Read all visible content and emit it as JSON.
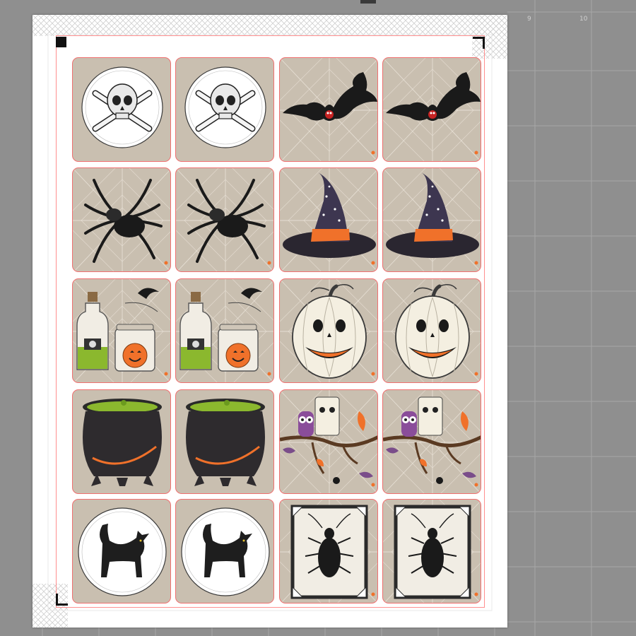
{
  "canvas": {
    "background_color": "#8f8f8f",
    "ruler_labels": [
      "9",
      "10"
    ]
  },
  "page": {
    "cut_line_color": "#ff8f8f",
    "registration_color": "#111111"
  },
  "stickers": [
    {
      "image": "skull-and-crossbones",
      "frame": "white-circle"
    },
    {
      "image": "skull-and-crossbones",
      "frame": "white-circle"
    },
    {
      "image": "bat",
      "frame": "cobweb"
    },
    {
      "image": "bat",
      "frame": "cobweb"
    },
    {
      "image": "spider",
      "frame": "cobweb"
    },
    {
      "image": "spider",
      "frame": "cobweb"
    },
    {
      "image": "witch-hat",
      "frame": "cobweb"
    },
    {
      "image": "witch-hat",
      "frame": "cobweb"
    },
    {
      "image": "potion-bottles",
      "frame": "cobweb"
    },
    {
      "image": "potion-bottles",
      "frame": "cobweb"
    },
    {
      "image": "jack-o-lantern",
      "frame": "cobweb"
    },
    {
      "image": "jack-o-lantern",
      "frame": "cobweb"
    },
    {
      "image": "cauldron",
      "frame": "cobweb"
    },
    {
      "image": "cauldron",
      "frame": "cobweb"
    },
    {
      "image": "owls-on-branch",
      "frame": "cobweb"
    },
    {
      "image": "owls-on-branch",
      "frame": "cobweb"
    },
    {
      "image": "black-cat",
      "frame": "white-circle"
    },
    {
      "image": "black-cat",
      "frame": "white-circle"
    },
    {
      "image": "framed-beetle",
      "frame": "cobweb"
    },
    {
      "image": "framed-beetle",
      "frame": "cobweb"
    }
  ],
  "colors": {
    "sticker_background": "#c9bfb0",
    "web": "#ece6dc",
    "orange": "#f0712a",
    "potion_green": "#8bb82e",
    "hat_purple": "#3d3650",
    "sticker_border": "#f07070"
  }
}
